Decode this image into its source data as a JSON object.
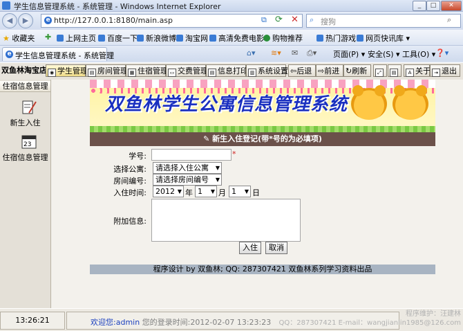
{
  "window": {
    "title": "学生信息管理系统 - 系统管理 - Windows Internet Explorer"
  },
  "address_bar": {
    "url": "http://127.0.0.1:8180/main.asp",
    "search_placeholder": "搜狗"
  },
  "favorites": {
    "label": "收藏夹",
    "links": [
      "上网主页",
      "百度一下",
      "新浪微博",
      "淘宝网",
      "高清免费电影",
      "购物推荐",
      "热门游戏",
      "网页快讯库 ▾"
    ]
  },
  "tab": {
    "title": "学生信息管理系统 - 系统管理"
  },
  "command_bar": {
    "page": "页面(P) ▾",
    "safety": "安全(S) ▾",
    "tools": "工具(O) ▾",
    "help": "❓▾"
  },
  "app_toolbar": {
    "brand": "双鱼林淘宝店",
    "buttons": [
      "学生管理",
      "房间管理",
      "住宿管理",
      "交费管理",
      "信息打印",
      "系统设置",
      "后退",
      "前进",
      "刷新",
      "关于",
      "退出"
    ]
  },
  "sidebar": {
    "heading": "住宿信息管理",
    "items": [
      "新生入住",
      "住宿信息管理"
    ]
  },
  "banner": {
    "title": "双鱼林学生公寓信息管理系统"
  },
  "form": {
    "heading": "新生入住登记(带*号的为必填项)",
    "student_id_label": "学号:",
    "student_id_value": "",
    "required_mark": "*",
    "apartment_label": "选择公寓:",
    "apartment_value": "请选择入住公寓",
    "room_label": "房间编号:",
    "room_value": "请选择房间编号",
    "date_label": "入住时间:",
    "year_value": "2012",
    "year_unit": "年",
    "month_value": "1",
    "month_unit": "月",
    "day_value": "1",
    "day_unit": "日",
    "notes_label": "附加信息:",
    "notes_value": "",
    "submit_label": "入住",
    "cancel_label": "取消",
    "footer": "程序设计  by 双鱼林; QQ: 287307421 双鱼林系列学习资料出品"
  },
  "status": {
    "clock": "13:26:21",
    "welcome_prefix": "欢迎您:",
    "username": "admin",
    "last_login": "您的登录时间:2012-02-07 13:23:23",
    "credits_line1": "程序维护：汪建林",
    "credits_line2": "QQ：287307421 E-mail：wangjianlin1985@126.com"
  },
  "colors": {
    "form_header": "#6b514a",
    "banner_title": "#1a30c0",
    "username": "#1a3fbf"
  }
}
